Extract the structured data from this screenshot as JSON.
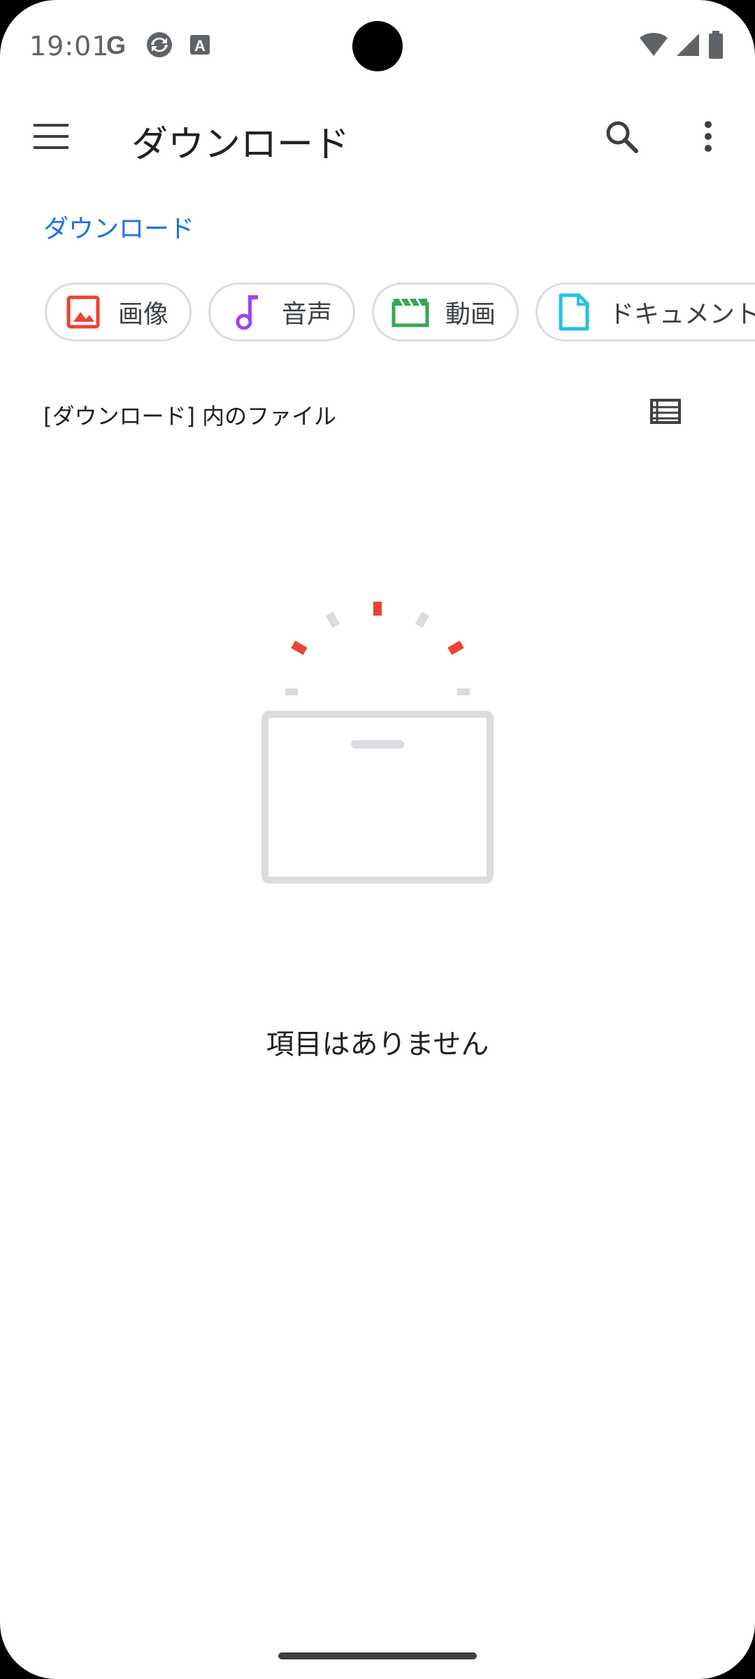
{
  "status_bar": {
    "time": "19:01",
    "left_icons": [
      "google-icon",
      "sync-icon",
      "font-icon"
    ],
    "right_icons": [
      "wifi-icon",
      "signal-icon",
      "battery-icon"
    ]
  },
  "app_bar": {
    "title": "ダウンロード",
    "icons": [
      "menu-icon",
      "search-icon",
      "more-vert-icon"
    ]
  },
  "breadcrumb": "ダウンロード",
  "chips": [
    {
      "label": "画像",
      "icon": "image-icon",
      "color": "#ea4335"
    },
    {
      "label": "音声",
      "icon": "music-note-icon",
      "color": "#a142f4"
    },
    {
      "label": "動画",
      "icon": "movie-icon",
      "color": "#34a853"
    },
    {
      "label": "ドキュメント",
      "icon": "document-icon",
      "color": "#24c1e0"
    }
  ],
  "section_title": "[ダウンロード] 内のファイル",
  "empty_state": {
    "message": "項目はありません"
  },
  "colors": {
    "accent": "#1a73e8",
    "illustration_red": "#ea4335",
    "illustration_gray": "#dadce0"
  }
}
